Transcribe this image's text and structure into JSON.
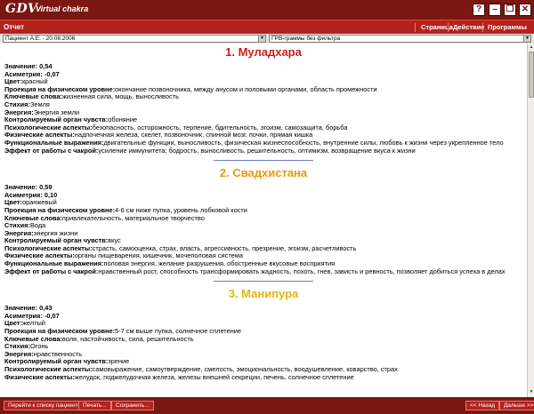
{
  "titlebar": {
    "logo": "GDV",
    "subtitle": "Virtual chakra",
    "help_label": "?",
    "minimize_label": "–",
    "restore_label": "❐",
    "close_label": "✕"
  },
  "menubar": {
    "report_tab": "Отчет",
    "items": [
      "Страница",
      "Действие",
      "Программы"
    ]
  },
  "filters": {
    "patient": "Пациент А.Е. - 20.08.2006",
    "filter": "ГРВ-граммы без фильтра"
  },
  "labels": {
    "value": "Значение:",
    "asymmetry": "Асиметрия:",
    "color": "Цвет:",
    "projection": "Проекция на физическом уровне:",
    "keywords": "Ключевые слова:",
    "element": "Стихия:",
    "energy": "Энергия:",
    "sense": "Контролируемый орган чувств:",
    "psych": "Психологические аспекты:",
    "physical": "Физические аспекты:",
    "functional": "Функциональные выражения:",
    "effect": "Эффект от работы с чакрой:"
  },
  "chakras": [
    {
      "title": "1. Муладхара",
      "title_color": "#c8201a",
      "value": "0,54",
      "asymmetry": "-0,07",
      "color": "красный",
      "projection": "окончание позвоночника, между анусом и половыми органами, область промежности",
      "keywords": "жизненная сила, мощь, выносливость",
      "element": "Земля",
      "energy": "Энергия земли",
      "sense": "обоняние",
      "psych": "безопасность, осторожность, терпение, бдительность, эгоизм, самозащита, борьба",
      "physical": "надпочечная железа, скелет, позвоночник, спинной мозг, почки, прямая кишка",
      "functional": "двигательные функции, выносливость, физическая жизнеспособность, внутренние силы, любовь к жизни через укрепленное тело",
      "effect": "усиление иммунитета; бодрость, выносливость, решительность, оптимизм, возвращение вкуса к жизни"
    },
    {
      "title": "2. Свадхистана",
      "title_color": "#e8980e",
      "value": "0,59",
      "asymmetry": "0,10",
      "color": "оранжевый",
      "projection": "4-6 см ниже пупка, уровень лобковой кости",
      "keywords": "привлекательность, материальное творчество",
      "element": "Вода",
      "energy": "энергия жизни",
      "sense": "вкус",
      "psych": "страсть, самооценка, страх, власть, агрессивность, презрение, эгоизм, расчетливость",
      "physical": "органы пищеварения, кишечник, мочеполовая система",
      "functional": "половая энергия, желание разрушения, обостренные вкусовые восприятия",
      "effect": "нравственный рост, способность трансформировать жадность, похоть, гнев, зависть и ревность, позволяет добиться успеха в делах"
    },
    {
      "title": "3. Манипура",
      "title_color": "#e8b20e",
      "value": "0,43",
      "asymmetry": "-0,07",
      "color": "желтый",
      "projection": "5-7 см выше пупка, солнечное сплетение",
      "keywords": "воля, настойчивость, сила, решительность",
      "element": "Огонь",
      "energy": "нравственность",
      "sense": "зрение",
      "psych": "самовыражение, самоутверждение, смелость, эмоциональность, воодушевление, коварство, страх",
      "physical": "желудок, поджелудочная железа, железы внешней секреции, печень, солнечное сплетение"
    }
  ],
  "bottombar": {
    "patients_button": "Перейти к списку пациентов",
    "print_button": "Печать...",
    "save_button": "Сохранить...",
    "back_button": "<< Назад",
    "next_button": "Дальше >>"
  }
}
